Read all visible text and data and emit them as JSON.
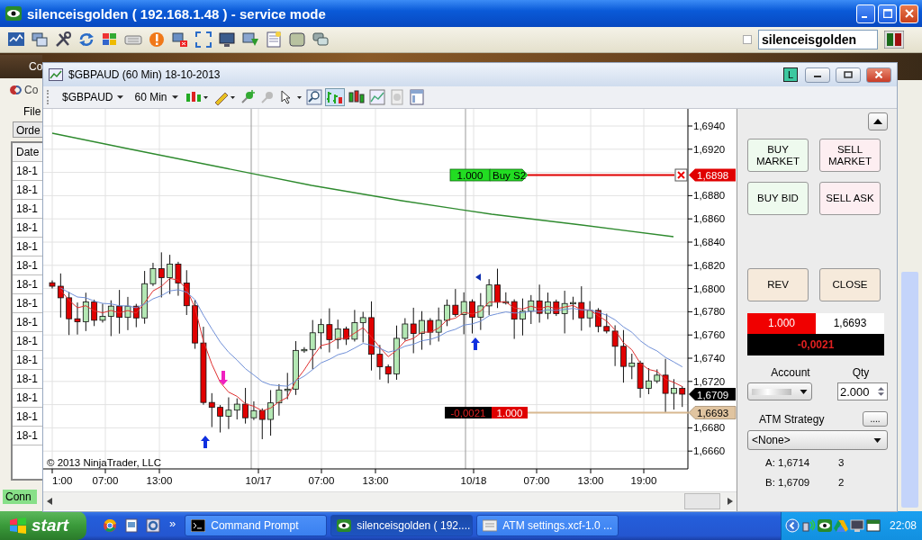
{
  "window": {
    "title": "silenceisgolden ( 192.168.1.48 ) - service mode"
  },
  "toolbar": {
    "checkbox": {
      "checked": false
    },
    "user_field": {
      "value": "silenceisgolden"
    }
  },
  "background_window": {
    "title": "Co",
    "panel_title": "Co",
    "menu": "File",
    "tab": "Orde",
    "column": "Date",
    "rows": [
      "18-1",
      "18-1",
      "18-1",
      "18-1",
      "18-1",
      "18-1",
      "18-1",
      "18-1",
      "18-1",
      "18-1",
      "18-1",
      "18-1",
      "18-1",
      "18-1",
      "18-1"
    ],
    "status": "Conn"
  },
  "chart_window": {
    "title": "$GBPAUD (60 Min)  18-10-2013",
    "mode_badge": "L",
    "instrument": "$GBPAUD",
    "interval": "60 Min",
    "y_ticks": [
      "1,6940",
      "1,6920",
      "1,6880",
      "1,6860",
      "1,6840",
      "1,6820",
      "1,6800",
      "1,6780",
      "1,6760",
      "1,6740",
      "1,6720",
      "1,6680",
      "1,6660"
    ],
    "x_labels": [
      "1:00",
      "07:00",
      "13:00",
      "10/17",
      "07:00",
      "13:00",
      "10/18",
      "07:00",
      "13:00",
      "19:00"
    ],
    "copyright": "© 2013 NinjaTrader, LLC",
    "order": {
      "quantity": "1.000",
      "name": "Buy S2",
      "price": "1,6898"
    },
    "position": {
      "pnl": "-0,0021",
      "quantity": "1.000",
      "price": "1,6693"
    },
    "last_price": "1,6709"
  },
  "order_panel": {
    "buttons": [
      {
        "label": "BUY MARKET",
        "kind": "buy"
      },
      {
        "label": "SELL MARKET",
        "kind": "sell"
      },
      {
        "label": "BUY BID",
        "kind": "buy"
      },
      {
        "label": "SELL ASK",
        "kind": "sell"
      }
    ],
    "actions": [
      {
        "label": "REV",
        "kind": "neutral"
      },
      {
        "label": "CLOSE",
        "kind": "neutral"
      }
    ],
    "position": {
      "quantity": "1.000",
      "price": "1,6693",
      "pnl": "-0,0021"
    },
    "account_label": "Account",
    "qty_label": "Qty",
    "qty": "2.000",
    "atm_label": "ATM Strategy",
    "atm_button": "....",
    "atm_value": "<None>",
    "quotes": [
      {
        "label": "A: 1,6714",
        "size": "3"
      },
      {
        "label": "B: 1,6709",
        "size": "2"
      }
    ]
  },
  "taskbar": {
    "start": "start",
    "overflow": "»",
    "tasks": [
      {
        "label": "Command Prompt",
        "selected": false
      },
      {
        "label": "silenceisgolden ( 192....",
        "selected": true
      },
      {
        "label": "ATM settings.xcf-1.0 ...",
        "selected": false
      }
    ],
    "clock": "22:08"
  }
}
